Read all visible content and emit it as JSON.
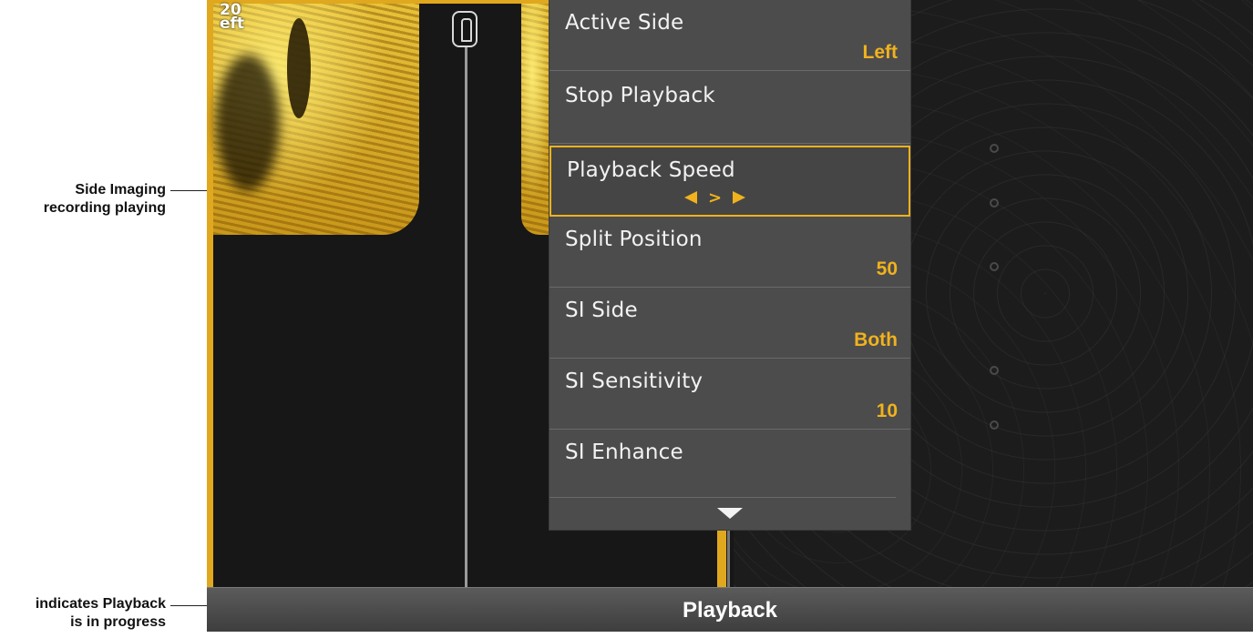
{
  "callouts": {
    "side_imaging": "Side Imaging recording playing",
    "side_imaging_line1": "Side Imaging",
    "side_imaging_line2": "recording playing",
    "playback_line1": "indicates Playback",
    "playback_line2": "is in progress"
  },
  "sonar": {
    "depth_label_line1": "20",
    "depth_label_line2": "eft"
  },
  "menu": {
    "items": [
      {
        "label": "Active Side",
        "value": "Left"
      },
      {
        "label": "Stop Playback",
        "value": ""
      },
      {
        "label": "Playback Speed",
        "value": ">",
        "selected": true
      },
      {
        "label": "Split Position",
        "value": "50"
      },
      {
        "label": "SI Side",
        "value": "Both"
      },
      {
        "label": "SI Sensitivity",
        "value": "10"
      },
      {
        "label": "SI Enhance",
        "value": ""
      }
    ],
    "more_icon": "chevron-down-icon"
  },
  "status_bar": {
    "text": "Playback"
  },
  "colors": {
    "accent": "#f0b21e",
    "menu_bg": "#4c4c4c",
    "status_bg": "#4a4a4a"
  }
}
